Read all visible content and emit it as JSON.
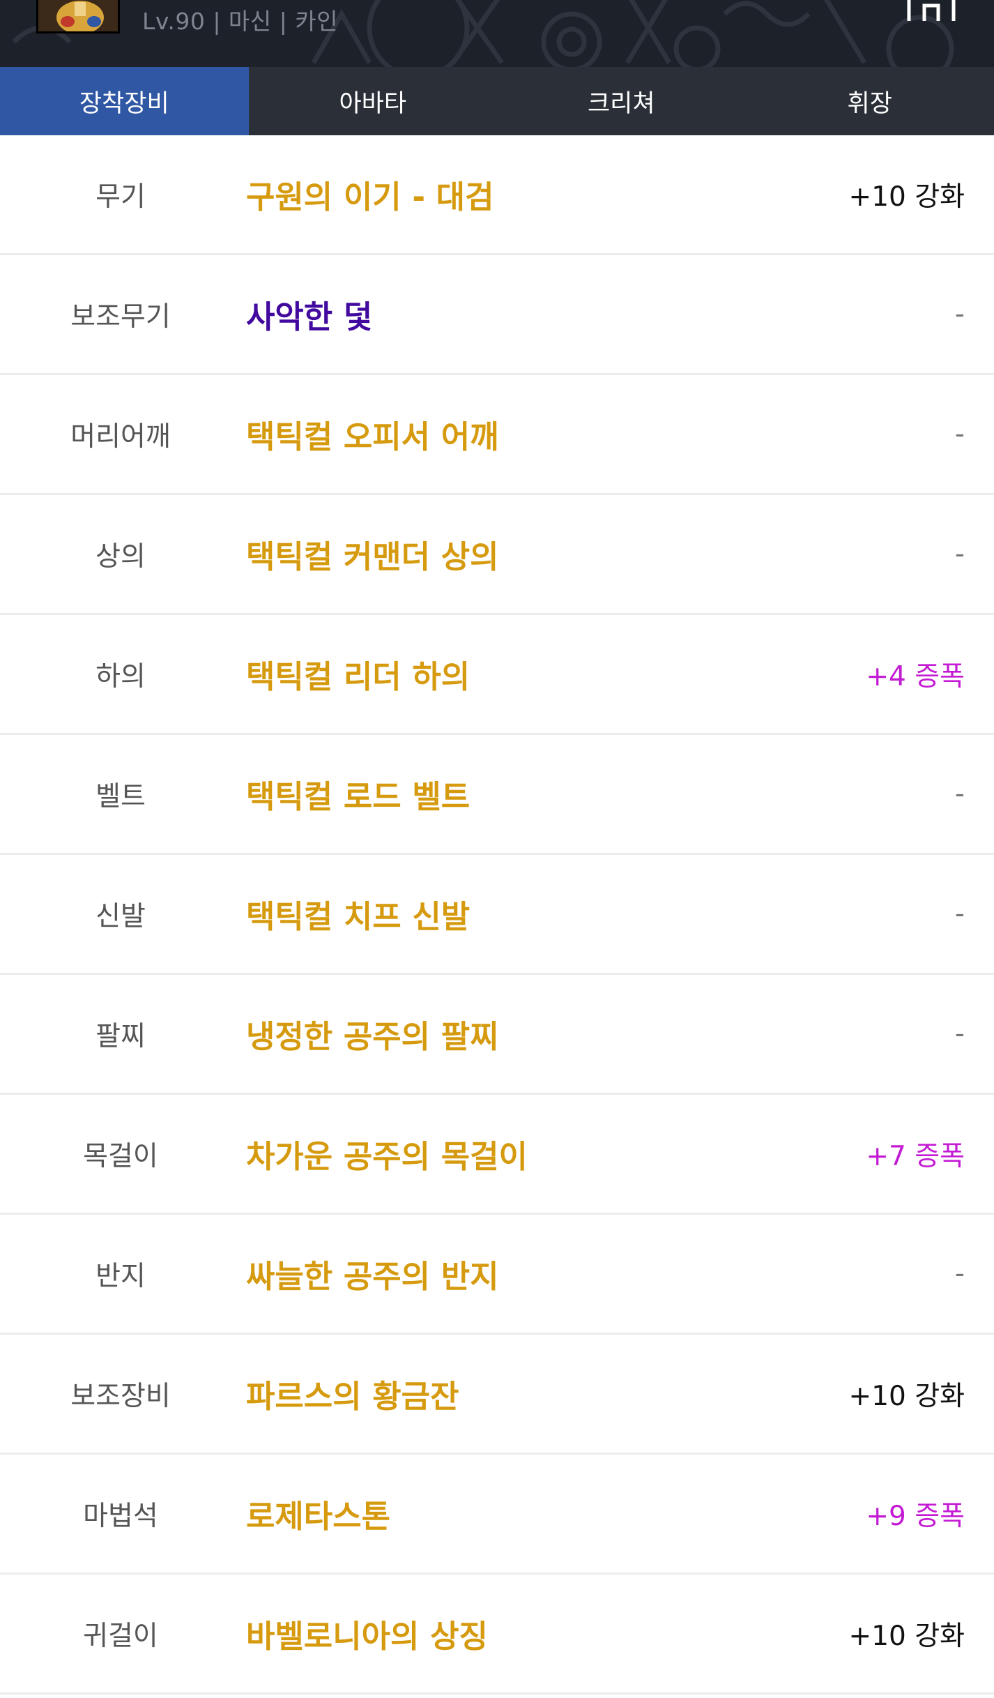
{
  "character": {
    "info": "Lv.90 | 마신 | 카인"
  },
  "icons": {
    "avatar": "character-portrait",
    "home": "home-icon"
  },
  "tabs": [
    {
      "label": "장착장비",
      "active": true
    },
    {
      "label": "아바타",
      "active": false
    },
    {
      "label": "크리쳐",
      "active": false
    },
    {
      "label": "휘장",
      "active": false
    }
  ],
  "colors": {
    "header_bg": "#1d2129",
    "tab_bar": "#2b3038",
    "tab_active": "#2f57a4",
    "epic": "#d69a0f",
    "unique": "#42099f",
    "amplify": "#c31bd3",
    "reinforce": "#111111",
    "none": "#777777"
  },
  "equipment": [
    {
      "slot": "무기",
      "item": "구원의 이기 - 대검",
      "rarity": "epic",
      "enhance": "+10 강화",
      "type": "reinforce"
    },
    {
      "slot": "보조무기",
      "item": "사악한 덫",
      "rarity": "unique",
      "enhance": "-",
      "type": "none"
    },
    {
      "slot": "머리어깨",
      "item": "택틱컬 오피서 어깨",
      "rarity": "epic",
      "enhance": "-",
      "type": "none"
    },
    {
      "slot": "상의",
      "item": "택틱컬 커맨더 상의",
      "rarity": "epic",
      "enhance": "-",
      "type": "none"
    },
    {
      "slot": "하의",
      "item": "택틱컬 리더 하의",
      "rarity": "epic",
      "enhance": "+4 증폭",
      "type": "amplify"
    },
    {
      "slot": "벨트",
      "item": "택틱컬 로드 벨트",
      "rarity": "epic",
      "enhance": "-",
      "type": "none"
    },
    {
      "slot": "신발",
      "item": "택틱컬 치프 신발",
      "rarity": "epic",
      "enhance": "-",
      "type": "none"
    },
    {
      "slot": "팔찌",
      "item": "냉정한 공주의 팔찌",
      "rarity": "epic",
      "enhance": "-",
      "type": "none"
    },
    {
      "slot": "목걸이",
      "item": "차가운 공주의 목걸이",
      "rarity": "epic",
      "enhance": "+7 증폭",
      "type": "amplify"
    },
    {
      "slot": "반지",
      "item": "싸늘한 공주의 반지",
      "rarity": "epic",
      "enhance": "-",
      "type": "none"
    },
    {
      "slot": "보조장비",
      "item": "파르스의 황금잔",
      "rarity": "epic",
      "enhance": "+10 강화",
      "type": "reinforce"
    },
    {
      "slot": "마법석",
      "item": "로제타스톤",
      "rarity": "epic",
      "enhance": "+9 증폭",
      "type": "amplify"
    },
    {
      "slot": "귀걸이",
      "item": "바벨로니아의 상징",
      "rarity": "epic",
      "enhance": "+10 강화",
      "type": "reinforce"
    }
  ]
}
